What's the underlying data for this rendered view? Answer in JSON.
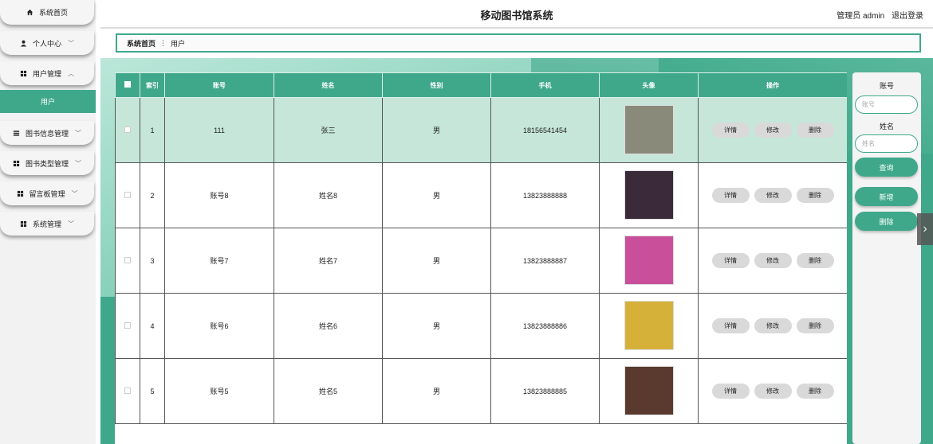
{
  "header": {
    "title": "移动图书馆系统",
    "user": "管理员 admin",
    "logout": "退出登录"
  },
  "sidebar": {
    "items": [
      {
        "label": "系统首页",
        "icon": "home-icon",
        "chevron": ""
      },
      {
        "label": "个人中心",
        "icon": "person-icon",
        "chevron": "﹀"
      },
      {
        "label": "用户管理",
        "icon": "grid-icon",
        "chevron": "︿"
      },
      {
        "label": "图书信息管理",
        "icon": "list-icon",
        "chevron": "﹀"
      },
      {
        "label": "图书类型管理",
        "icon": "grid-icon",
        "chevron": "﹀"
      },
      {
        "label": "留言板管理",
        "icon": "grid-icon",
        "chevron": "﹀"
      },
      {
        "label": "系统管理",
        "icon": "grid-icon",
        "chevron": "﹀"
      }
    ],
    "sub_item": "用户"
  },
  "breadcrumb": {
    "home": "系统首页",
    "sep": "⋮",
    "current": "用户"
  },
  "table": {
    "headers": [
      "索引",
      "账号",
      "姓名",
      "性别",
      "手机",
      "头像",
      "操作"
    ],
    "ops": [
      "详情",
      "修改",
      "删除"
    ],
    "rows": [
      {
        "index": "1",
        "account": "111",
        "name": "张三",
        "gender": "男",
        "phone": "18156541454",
        "avatar": "avatar-photo-1",
        "avatar_color": "#8a8a7a"
      },
      {
        "index": "2",
        "account": "账号8",
        "name": "姓名8",
        "gender": "男",
        "phone": "13823888888",
        "avatar": "avatar-photo-2",
        "avatar_color": "#3a2a3a"
      },
      {
        "index": "3",
        "account": "账号7",
        "name": "姓名7",
        "gender": "男",
        "phone": "13823888887",
        "avatar": "avatar-photo-3",
        "avatar_color": "#c94f9a"
      },
      {
        "index": "4",
        "account": "账号6",
        "name": "姓名6",
        "gender": "男",
        "phone": "13823888886",
        "avatar": "avatar-photo-4",
        "avatar_color": "#d6b13a"
      },
      {
        "index": "5",
        "account": "账号5",
        "name": "姓名5",
        "gender": "男",
        "phone": "13823888885",
        "avatar": "avatar-photo-5",
        "avatar_color": "#5a3a2e"
      }
    ]
  },
  "search": {
    "account_label": "账号",
    "account_placeholder": "账号",
    "name_label": "姓名",
    "name_placeholder": "姓名",
    "query_button": "查询",
    "add_button": "新增",
    "delete_button": "删除"
  },
  "colors": {
    "accent": "#3fa88a",
    "selected_row": "#c6e6da"
  }
}
